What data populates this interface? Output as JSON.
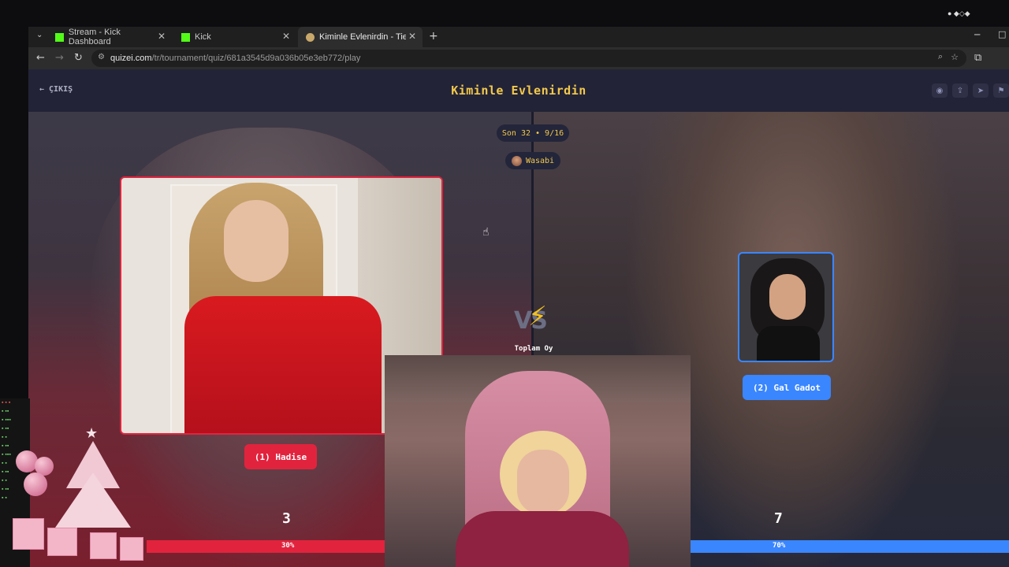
{
  "browser": {
    "tabs": [
      {
        "title": "Stream - Kick Dashboard",
        "close": "✕"
      },
      {
        "title": "Kick",
        "close": "✕"
      },
      {
        "title": "Kiminle Evlenirdin - Tier List, Kr",
        "close": "✕"
      }
    ],
    "new_tab": "+",
    "url_host": "quizei.com",
    "url_path": "/tr/tournament/quiz/681a3545d9a036b05e3eb772/play"
  },
  "header": {
    "exit_label": "ÇIKIŞ",
    "title": "Kiminle Evlenirdin"
  },
  "round": {
    "label": "Son 32 • 9/16",
    "user": "Wasabi"
  },
  "left": {
    "button": "(1) Hadise",
    "votes": "3",
    "percent": "30%"
  },
  "right": {
    "button": "(2) Gal Gadot",
    "votes": "7",
    "percent": "70%"
  },
  "vs": {
    "total_label": "Toplam Oy"
  },
  "progress": {
    "left_fraction": 0.3
  },
  "colors": {
    "accent_red": "#e2233d",
    "accent_blue": "#3a86ff",
    "title_gold": "#f2c94c"
  }
}
